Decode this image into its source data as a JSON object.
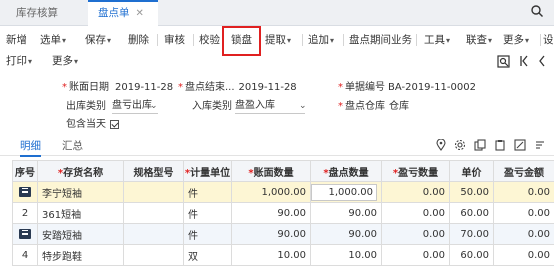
{
  "tabs": {
    "inactive": "库存核算",
    "active": "盘点单",
    "close": "✕"
  },
  "toolbar": {
    "items": [
      "新增",
      "选单",
      "保存",
      "删除",
      "审核",
      "校验",
      "锁盘",
      "提取",
      "追加",
      "盘点期间业务",
      "工具",
      "联查",
      "更多",
      "设置"
    ],
    "highlighted": "锁盘",
    "highlight_color": "#e02020"
  },
  "toolbar2": {
    "print": "打印",
    "more": "更多"
  },
  "form": {
    "date_label": "账面日期",
    "date_value": "2019-11-28",
    "enddate_label": "盘点结束...",
    "enddate_value": "2019-11-28",
    "docno_label": "单据编号",
    "docno_value": "BA-2019-11-0002",
    "outtype_label": "出库类别",
    "outtype_value": "盘亏出库",
    "intype_label": "入库类别",
    "intype_value": "盘盈入库",
    "warehouse_label": "盘点仓库",
    "warehouse_value": "仓库",
    "include_label": "包含当天"
  },
  "subtabs": {
    "detail": "明细",
    "summary": "汇总"
  },
  "table": {
    "headers": [
      "序号",
      "存货名称",
      "规格型号",
      "计量单位",
      "账面数量",
      "盘点数量",
      "盈亏数量",
      "单价",
      "盈亏金额"
    ],
    "rows": [
      {
        "seq": "",
        "name": "李宁短袖",
        "spec": "",
        "unit": "件",
        "book": "1,000.00",
        "count": "1,000.00",
        "diff": "0.00",
        "price": "50.00",
        "amount": "0.00"
      },
      {
        "seq": "2",
        "name": "361短袖",
        "spec": "",
        "unit": "件",
        "book": "90.00",
        "count": "90.00",
        "diff": "0.00",
        "price": "60.00",
        "amount": "0.00"
      },
      {
        "seq": "",
        "name": "安踏短袖",
        "spec": "",
        "unit": "件",
        "book": "90.00",
        "count": "90.00",
        "diff": "0.00",
        "price": "70.00",
        "amount": "0.00"
      },
      {
        "seq": "4",
        "name": "特步跑鞋",
        "spec": "",
        "unit": "双",
        "book": "10.00",
        "count": "10.00",
        "diff": "0.00",
        "price": "60.00",
        "amount": "0.00"
      }
    ]
  },
  "colors": {
    "accent": "#1f6fd0",
    "required": "#e02020",
    "row_highlight": "#fdf6d4"
  }
}
